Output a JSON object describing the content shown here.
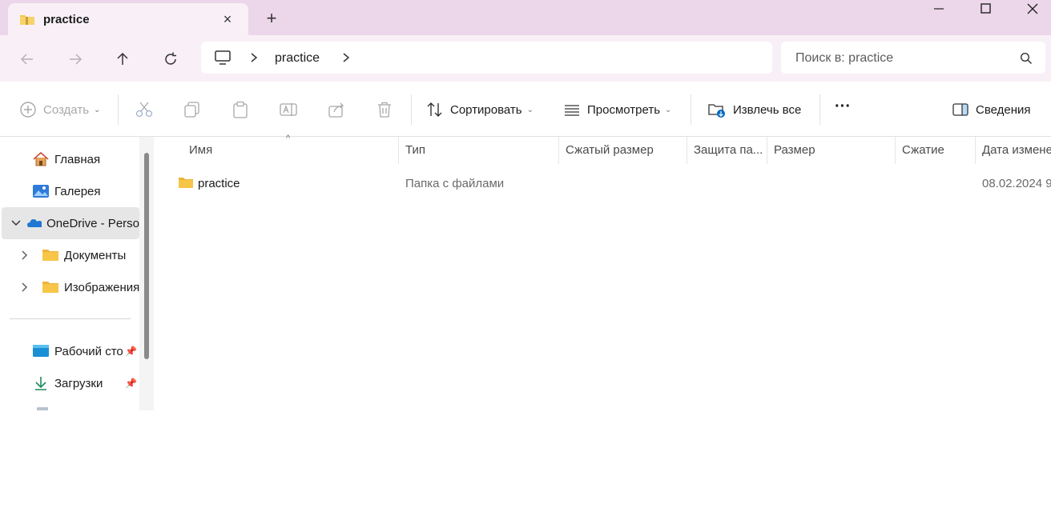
{
  "window": {
    "tab_title": "practice",
    "new_tab_symbol": "+",
    "close_tab_symbol": "×"
  },
  "address": {
    "path": "practice"
  },
  "search": {
    "placeholder": "Поиск в: practice"
  },
  "toolbar": {
    "create_label": "Создать",
    "sort_label": "Сортировать",
    "view_label": "Просмотреть",
    "extract_label": "Извлечь все",
    "more_label": "···",
    "details_label": "Сведения"
  },
  "sidebar": {
    "items": [
      {
        "label": "Главная",
        "icon": "home-icon"
      },
      {
        "label": "Галерея",
        "icon": "gallery-icon"
      },
      {
        "label": "OneDrive - Perso",
        "icon": "onedrive-icon"
      },
      {
        "label": "Документы",
        "icon": "folder-icon"
      },
      {
        "label": "Изображения",
        "icon": "folder-icon"
      },
      {
        "label": "Рабочий сто",
        "icon": "desktop-icon"
      },
      {
        "label": "Загрузки",
        "icon": "download-icon"
      }
    ]
  },
  "columns": [
    "Имя",
    "Тип",
    "Сжатый размер",
    "Защита па...",
    "Размер",
    "Сжатие",
    "Дата измене"
  ],
  "files": [
    {
      "name": "practice",
      "type": "Папка с файлами",
      "date": "08.02.2024 9:"
    }
  ],
  "colors": {
    "titlebar": "#ecd6e9",
    "navbar": "#f8f0f6",
    "folder": "#f7c548",
    "accent": "#0067c0"
  }
}
